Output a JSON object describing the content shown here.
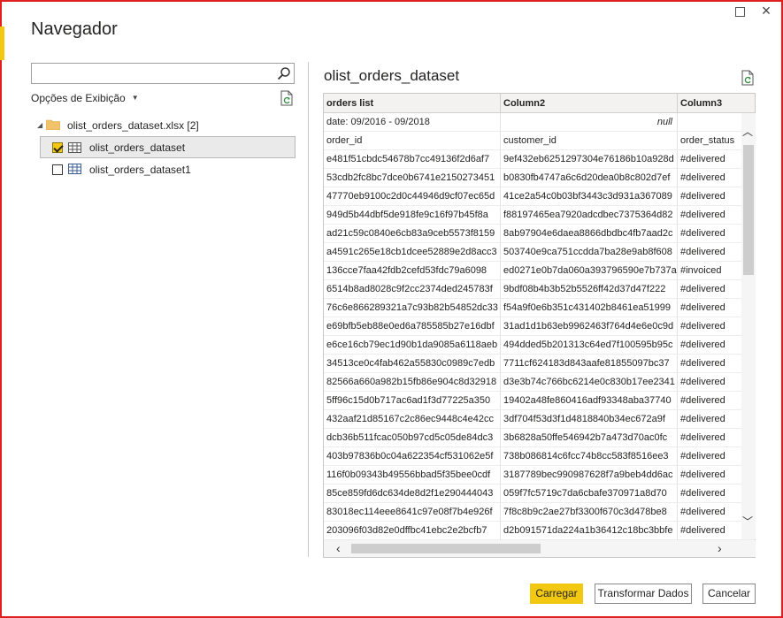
{
  "dialog": {
    "title": "Navegador",
    "close_glyph": "×"
  },
  "search": {
    "placeholder": "",
    "value": ""
  },
  "view_options": {
    "label": "Opções de Exibição"
  },
  "tree": {
    "file": "olist_orders_dataset.xlsx [2]",
    "items": [
      {
        "label": "olist_orders_dataset",
        "checked": true,
        "selected": true
      },
      {
        "label": "olist_orders_dataset1",
        "checked": false,
        "selected": false
      }
    ]
  },
  "preview": {
    "title": "olist_orders_dataset",
    "columns": [
      "orders list",
      "Column2",
      "Column3"
    ],
    "rows": [
      [
        "date: 09/2016 - 09/2018",
        "null",
        ""
      ],
      [
        "order_id",
        "customer_id",
        "order_status"
      ],
      [
        "e481f51cbdc54678b7cc49136f2d6af7",
        "9ef432eb6251297304e76186b10a928d",
        "#delivered"
      ],
      [
        "53cdb2fc8bc7dce0b6741e2150273451",
        "b0830fb4747a6c6d20dea0b8c802d7ef",
        "#delivered"
      ],
      [
        "47770eb9100c2d0c44946d9cf07ec65d",
        "41ce2a54c0b03bf3443c3d931a367089",
        "#delivered"
      ],
      [
        "949d5b44dbf5de918fe9c16f97b45f8a",
        "f88197465ea7920adcdbec7375364d82",
        "#delivered"
      ],
      [
        "ad21c59c0840e6cb83a9ceb5573f8159",
        "8ab97904e6daea8866dbdbc4fb7aad2c",
        "#delivered"
      ],
      [
        "a4591c265e18cb1dcee52889e2d8acc3",
        "503740e9ca751ccdda7ba28e9ab8f608",
        "#delivered"
      ],
      [
        "136cce7faa42fdb2cefd53fdc79a6098",
        "ed0271e0b7da060a393796590e7b737a",
        "#invoiced"
      ],
      [
        "6514b8ad8028c9f2cc2374ded245783f",
        "9bdf08b4b3b52b5526ff42d37d47f222",
        "#delivered"
      ],
      [
        "76c6e866289321a7c93b82b54852dc33",
        "f54a9f0e6b351c431402b8461ea51999",
        "#delivered"
      ],
      [
        "e69bfb5eb88e0ed6a785585b27e16dbf",
        "31ad1d1b63eb9962463f764d4e6e0c9d",
        "#delivered"
      ],
      [
        "e6ce16cb79ec1d90b1da9085a6118aeb",
        "494dded5b201313c64ed7f100595b95c",
        "#delivered"
      ],
      [
        "34513ce0c4fab462a55830c0989c7edb",
        "7711cf624183d843aafe81855097bc37",
        "#delivered"
      ],
      [
        "82566a660a982b15fb86e904c8d32918",
        "d3e3b74c766bc6214e0c830b17ee2341",
        "#delivered"
      ],
      [
        "5ff96c15d0b717ac6ad1f3d77225a350",
        "19402a48fe860416adf93348aba37740",
        "#delivered"
      ],
      [
        "432aaf21d85167c2c86ec9448c4e42cc",
        "3df704f53d3f1d4818840b34ec672a9f",
        "#delivered"
      ],
      [
        "dcb36b511fcac050b97cd5c05de84dc3",
        "3b6828a50ffe546942b7a473d70ac0fc",
        "#delivered"
      ],
      [
        "403b97836b0c04a622354cf531062e5f",
        "738b086814c6fcc74b8cc583f8516ee3",
        "#delivered"
      ],
      [
        "116f0b09343b49556bbad5f35bee0cdf",
        "3187789bec990987628f7a9beb4dd6ac",
        "#delivered"
      ],
      [
        "85ce859fd6dc634de8d2f1e290444043",
        "059f7fc5719c7da6cbafe370971a8d70",
        "#delivered"
      ],
      [
        "83018ec114eee8641c97e08f7b4e926f",
        "7f8c8b9c2ae27bf3300f670c3d478be8",
        "#delivered"
      ],
      [
        "203096f03d82e0dffbc41ebc2e2bcfb7",
        "d2b091571da224a1b36412c18bc3bbfe",
        "#delivered"
      ]
    ]
  },
  "buttons": {
    "load": "Carregar",
    "transform": "Transformar Dados",
    "cancel": "Cancelar"
  },
  "colors": {
    "accent": "#f2c811",
    "border": "#e02020"
  },
  "icons": [
    "search-icon",
    "refresh-icon",
    "folder-icon",
    "table-icon",
    "close-icon",
    "maximize-icon"
  ]
}
